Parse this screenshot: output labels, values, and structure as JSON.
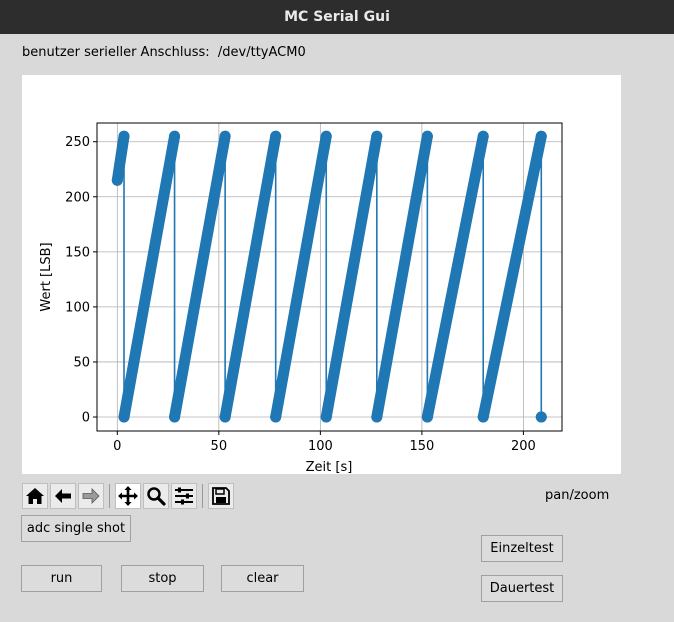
{
  "window": {
    "title": "MC Serial Gui"
  },
  "connection": {
    "label": "benutzer serieller Anschluss:",
    "port": "/dev/ttyACM0"
  },
  "toolbar": {
    "icons": [
      "home-icon",
      "back-icon",
      "forward-icon",
      "pan-icon",
      "zoom-icon",
      "configure-icon",
      "save-icon"
    ],
    "mode": "pan/zoom"
  },
  "buttons": {
    "adc_single_shot": "adc single shot",
    "run": "run",
    "stop": "stop",
    "clear": "clear",
    "einzeltest": "Einzeltest",
    "dauertest": "Dauertest"
  },
  "colors": {
    "series": "#1f77b4",
    "grid": "#b0b0b0"
  },
  "chart_data": {
    "type": "line",
    "title": "",
    "xlabel": "Zeit [s]",
    "ylabel": "Wert [LSB]",
    "xlim": [
      -10,
      219
    ],
    "ylim": [
      -12.7,
      267
    ],
    "xticks": [
      0,
      50,
      100,
      150,
      200
    ],
    "yticks": [
      0,
      50,
      100,
      150,
      200,
      250
    ],
    "grid": true,
    "marker": "circle",
    "series": [
      {
        "x": [
          0,
          3.3,
          3.3,
          28.2,
          28.2,
          53.1,
          53.1,
          78.0,
          78.0,
          102.9,
          102.9,
          127.8,
          127.8,
          152.7,
          152.7,
          180.2,
          180.2,
          208.8,
          208.8,
          208.8
        ],
        "y": [
          215,
          255,
          0,
          255,
          0,
          255,
          0,
          255,
          0,
          255,
          0,
          255,
          0,
          255,
          0,
          255,
          0,
          255,
          0,
          0
        ]
      }
    ]
  }
}
